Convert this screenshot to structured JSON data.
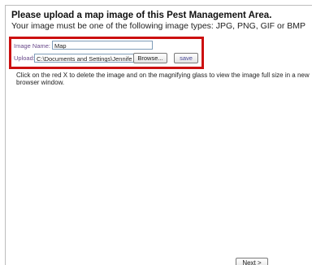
{
  "header": {
    "title": "Please upload a map image of this Pest Management Area.",
    "subtitle": "Your image must be one of the following image types: JPG, PNG, GIF or BMP"
  },
  "upload_form": {
    "image_name_label": "Image Name:",
    "image_name_value": "Map",
    "upload_label": "Upload:",
    "upload_value": "C:\\Documents and Settings\\Jennife",
    "browse_label": "Browse...",
    "save_label": "save"
  },
  "instructions": "Click on the red X to delete the image and on the magnifying glass to view the image full size in a new browser window.",
  "footer": {
    "next_label": "Next >"
  },
  "colors": {
    "highlight_border": "#cc1010",
    "label_text": "#6a4a8a"
  }
}
